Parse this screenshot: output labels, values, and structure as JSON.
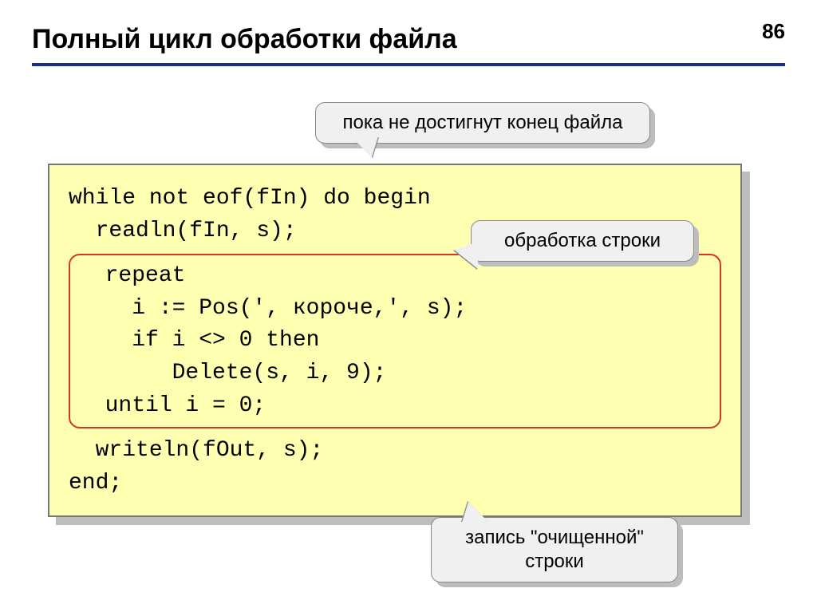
{
  "header": {
    "title": "Полный цикл обработки файла",
    "page": "86"
  },
  "callouts": {
    "top": "пока не достигнут конец файла",
    "right": "обработка строки",
    "bottom": "запись \"очищенной\"\nстроки"
  },
  "code": {
    "l1": "while not eof(fIn) do begin",
    "l2": "  readln(fIn, s);",
    "inner1": "  repeat",
    "inner2": "    i := Pos(', короче,', s);",
    "inner3": "    if i <> 0 then",
    "inner4": "       Delete(s, i, 9);",
    "inner5": "  until i = 0;",
    "l3": "  writeln(fOut, s);",
    "l4": "end;"
  }
}
